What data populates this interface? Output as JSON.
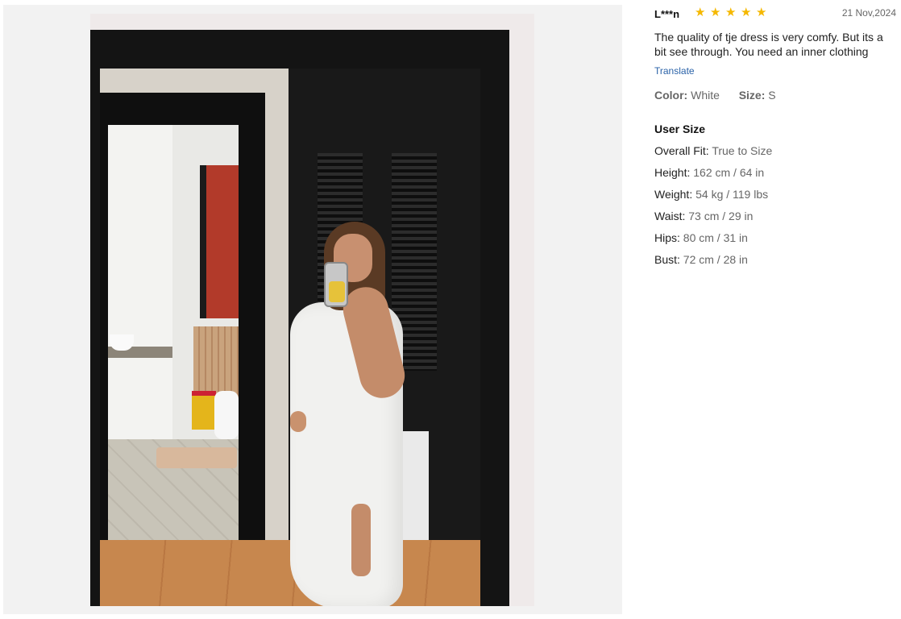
{
  "photo": {
    "alt": "Reviewer mirror selfie wearing a white dress"
  },
  "review": {
    "reviewer": "L***n",
    "rating": 5,
    "stars": [
      "★",
      "★",
      "★",
      "★",
      "★"
    ],
    "date": "21 Nov,2024",
    "text": "The quality of tje dress is very comfy. But its a bit see through. You need an inner clothing",
    "translate_label": "Translate",
    "color_key": "Color:",
    "color_value": "White",
    "size_key": "Size:",
    "size_value": "S",
    "user_size_title": "User Size",
    "user_size": [
      {
        "key": "Overall Fit:",
        "value": "True to Size"
      },
      {
        "key": "Height:",
        "value": "162 cm / 64 in"
      },
      {
        "key": "Weight:",
        "value": "54 kg / 119 lbs"
      },
      {
        "key": "Waist:",
        "value": "73 cm / 29 in"
      },
      {
        "key": "Hips:",
        "value": "80 cm / 31 in"
      },
      {
        "key": "Bust:",
        "value": "72 cm / 28 in"
      }
    ]
  },
  "colors": {
    "star": "#f5b800",
    "link": "#2a62a8",
    "muted": "#666666"
  }
}
